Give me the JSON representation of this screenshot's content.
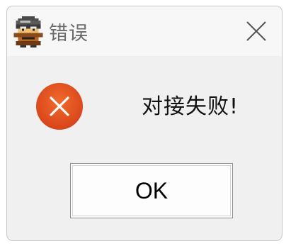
{
  "window": {
    "title": "错误",
    "app_icon": "pixel-character-icon",
    "close_icon": "close-icon"
  },
  "content": {
    "status_icon": "error-icon",
    "message": "对接失败!"
  },
  "buttons": {
    "ok_label": "OK"
  },
  "colors": {
    "error_red": "#e5531d",
    "title_text": "#6a6a6a",
    "dialog_bg": "#f0f0f0"
  }
}
